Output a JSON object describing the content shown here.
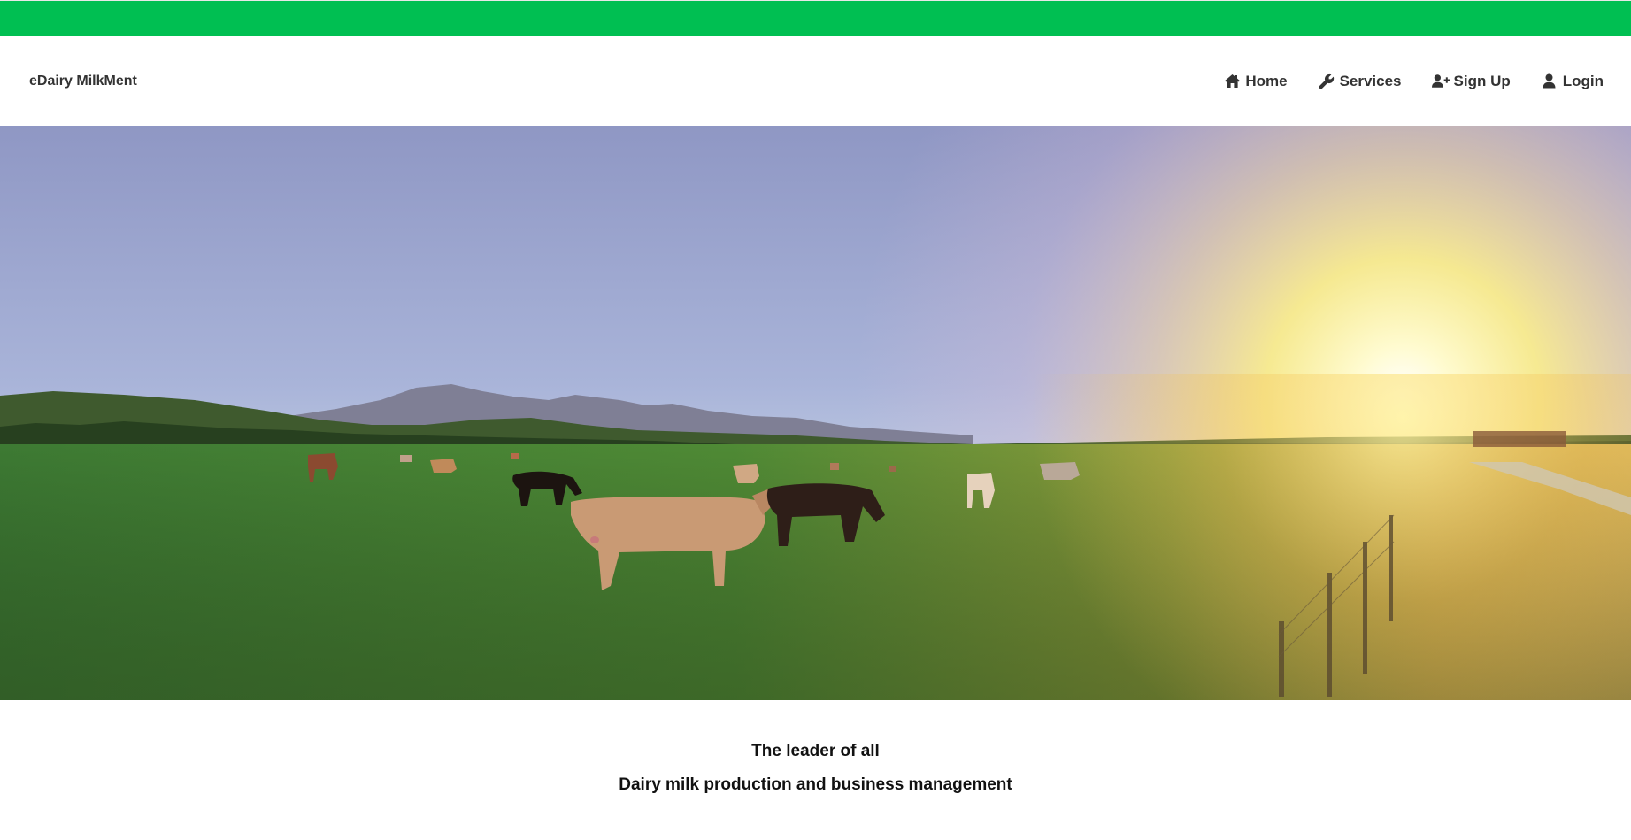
{
  "colors": {
    "top_bar": "#00bf52",
    "nav_text": "#333333",
    "tagline_text": "#111111"
  },
  "brand": {
    "label": "eDairy MilkMent"
  },
  "nav": {
    "items": [
      {
        "label": "Home",
        "icon": "home-icon"
      },
      {
        "label": "Services",
        "icon": "wrench-icon"
      },
      {
        "label": "Sign Up",
        "icon": "user-plus-icon"
      },
      {
        "label": "Login",
        "icon": "user-icon"
      }
    ]
  },
  "hero": {
    "image": "sunset-pasture-with-grazing-cows"
  },
  "tagline": {
    "line1": "The leader of all",
    "line2": "Dairy milk production and business management"
  }
}
